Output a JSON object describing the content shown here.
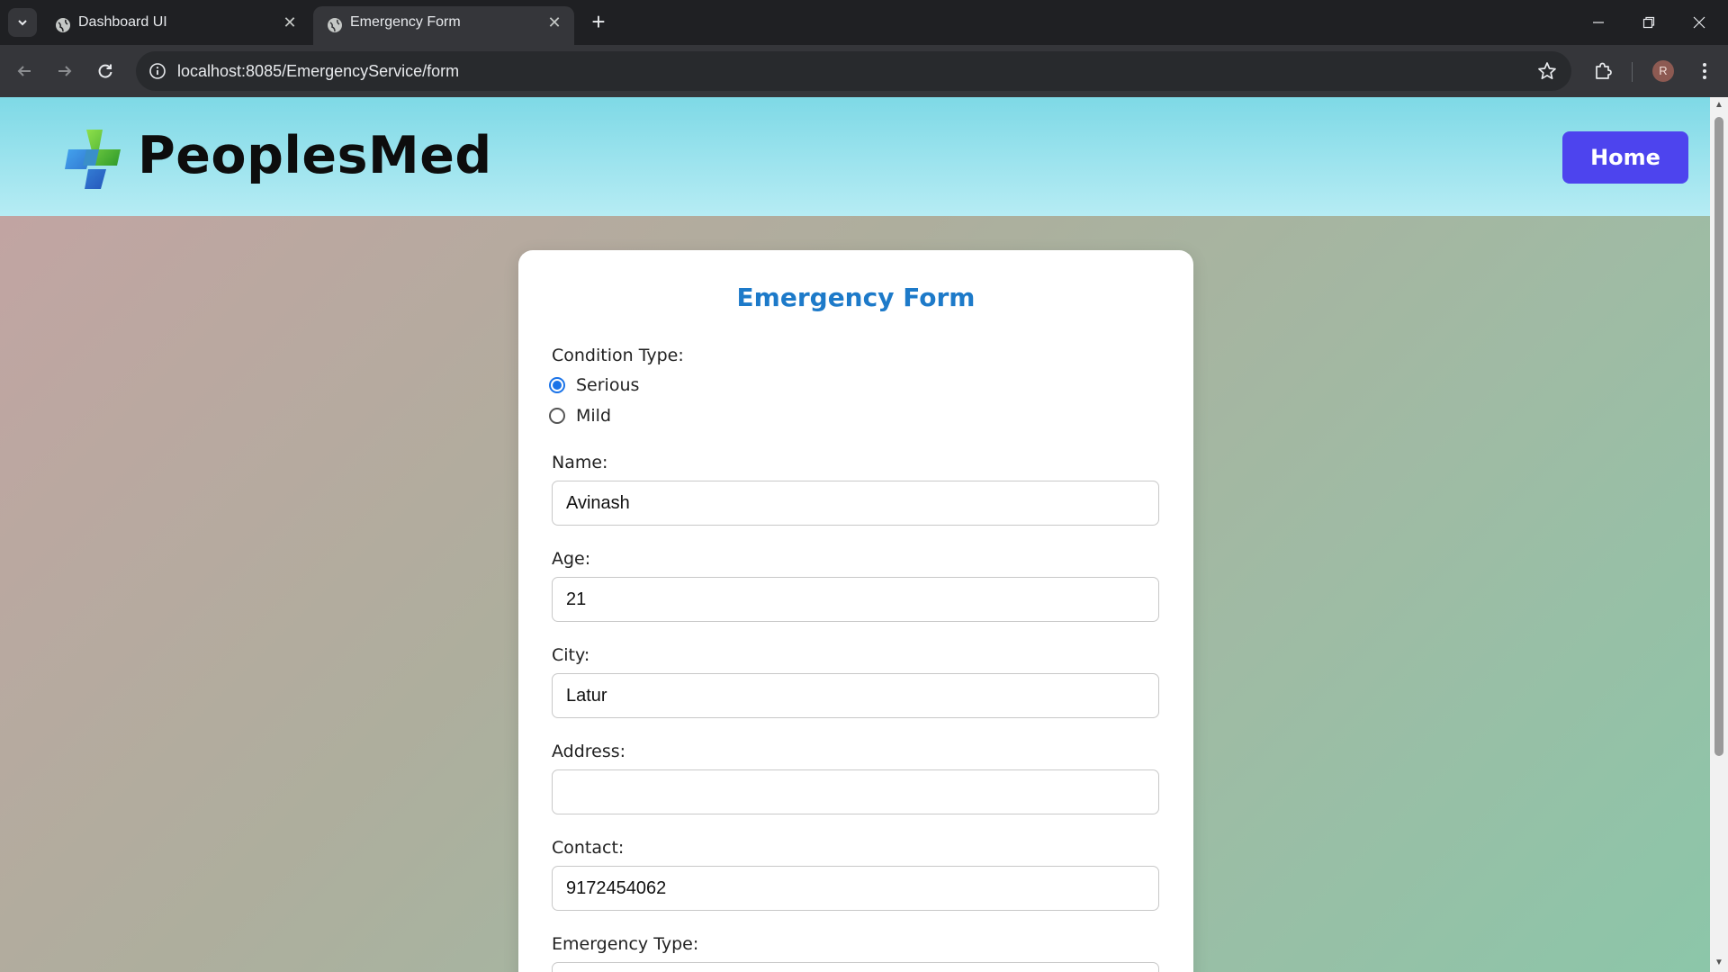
{
  "browser": {
    "tabs": [
      {
        "title": "Dashboard UI"
      },
      {
        "title": "Emergency Form"
      }
    ],
    "url": "localhost:8085/EmergencyService/form",
    "profile_initial": "R"
  },
  "header": {
    "brand": "PeoplesMed",
    "home_label": "Home"
  },
  "form": {
    "title": "Emergency Form",
    "condition_label": "Condition Type:",
    "condition_options": [
      {
        "label": "Serious",
        "checked": true
      },
      {
        "label": "Mild",
        "checked": false
      }
    ],
    "name_label": "Name:",
    "name_value": "Avinash",
    "age_label": "Age:",
    "age_value": "21",
    "city_label": "City:",
    "city_value": "Latur",
    "address_label": "Address:",
    "address_value": "",
    "contact_label": "Contact:",
    "contact_value": "9172454062",
    "emergency_type_label": "Emergency Type:"
  },
  "colors": {
    "brand_button": "#4d44ee",
    "title_blue": "#1d7ac9",
    "radio_selected": "#1a73e8"
  }
}
